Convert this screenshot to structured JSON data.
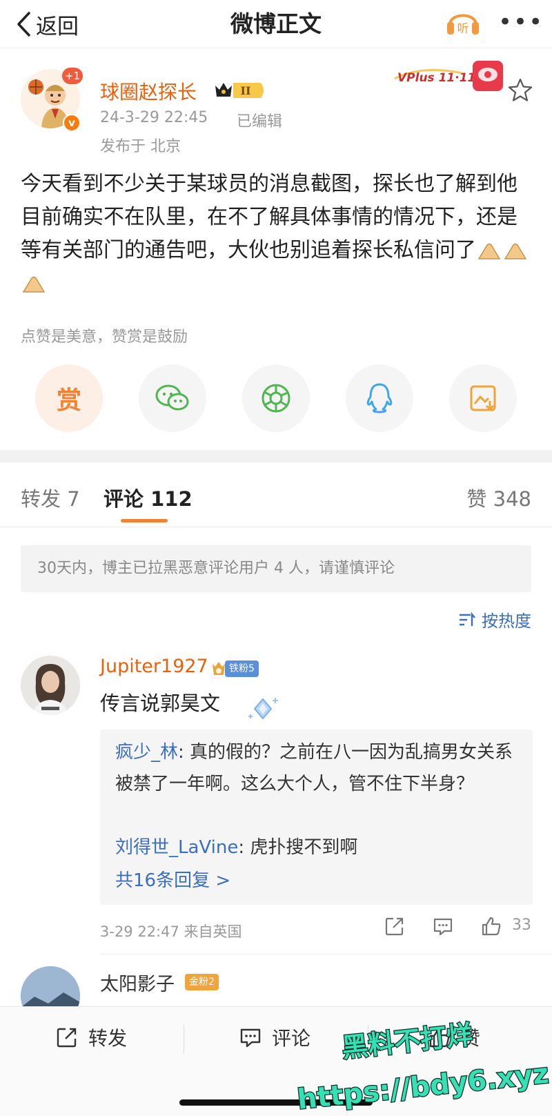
{
  "header": {
    "back_label": "返回",
    "title": "微博正文",
    "listen_label": "听",
    "more_label": "•••"
  },
  "author": {
    "name": "球圈赵探长",
    "notification_badge": "+1",
    "verified_mark": "v",
    "level_badge": "II",
    "time": "24-3-29 22:45",
    "edited": "已编辑",
    "location": "发布于 北京",
    "vplus_label": "VPlus 11·11"
  },
  "post": {
    "text": "今天看到不少关于某球员的消息截图，探长也了解到他目前确实不在队里，在不了解具体事情的情况下，还是等有关部门的通告吧，大伙也别追着探长私信问了"
  },
  "reward_hint": "点赞是美意，赞赏是鼓励",
  "share": {
    "reward_label": "赏",
    "items": [
      "wechat-icon",
      "moments-icon",
      "qq-icon",
      "save-image-icon"
    ]
  },
  "tabs": {
    "forward": "转发 7",
    "comment": "评论 112",
    "like": "赞 348"
  },
  "notice": "30天内，博主已拉黑恶意评论用户 4 人，请谨慎评论",
  "sort_label": "按热度",
  "comments": [
    {
      "user": "Jupiter1927",
      "badge": "铁粉5",
      "text": "传言说郭昊文",
      "replies": [
        {
          "user": "疯少_林",
          "text": ": 真的假的？之前在八一因为乱搞男女关系被禁了一年啊。这么大个人，管不住下半身？"
        },
        {
          "user": "刘得世_LaVine",
          "text": ": 虎扑搜不到啊"
        }
      ],
      "more_replies": "共16条回复 >",
      "meta": "3-29 22:47 来自英国",
      "likes": "33"
    },
    {
      "user": "太阳影子",
      "badge": "金粉2"
    }
  ],
  "bottom_bar": {
    "forward": "转发",
    "comment": "评论",
    "like": "赞"
  },
  "watermark": {
    "line1": "黑料不打烊",
    "line2": "https://bdy6.xyz"
  },
  "colors": {
    "accent": "#f08233",
    "name_orange": "#e8620d",
    "link_blue": "#3b6fbd"
  }
}
